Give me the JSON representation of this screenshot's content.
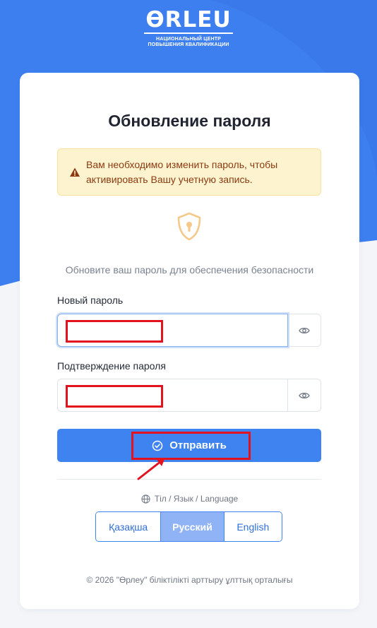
{
  "logo": {
    "mark": "ӨRLEU",
    "line1": "НАЦИОНАЛЬНЫЙ ЦЕНТР",
    "line2": "ПОВЫШЕНИЯ КВАЛИФИКАЦИИ"
  },
  "page_title": "Обновление пароля",
  "alert": {
    "icon": "warning-icon",
    "text": "Вам необходимо изменить пароль, чтобы активировать Вашу учетную запись."
  },
  "shield_icon": "shield-keyhole-icon",
  "subtitle": "Обновите ваш пароль для обеспечения безопасности",
  "form": {
    "new_password_label": "Новый пароль",
    "new_password_value": "",
    "confirm_password_label": "Подтверждение пароля",
    "confirm_password_value": "",
    "toggle_icon": "eye-icon",
    "submit_label": "Отправить",
    "submit_icon": "check-circle-icon"
  },
  "language": {
    "caption": "Тіл / Язык / Language",
    "icon": "globe-icon",
    "options": [
      "Қазақша",
      "Русский",
      "English"
    ],
    "selected": "Русский"
  },
  "footer": "© 2026 \"Өрлеу\" біліктілікті арттыру ұлттық орталығы",
  "colors": {
    "primary": "#3f83f0",
    "background_blue": "#3e7ff0",
    "alert_bg": "#fdf3cf",
    "alert_text": "#8a3b12",
    "annotation_red": "#e3121f"
  }
}
